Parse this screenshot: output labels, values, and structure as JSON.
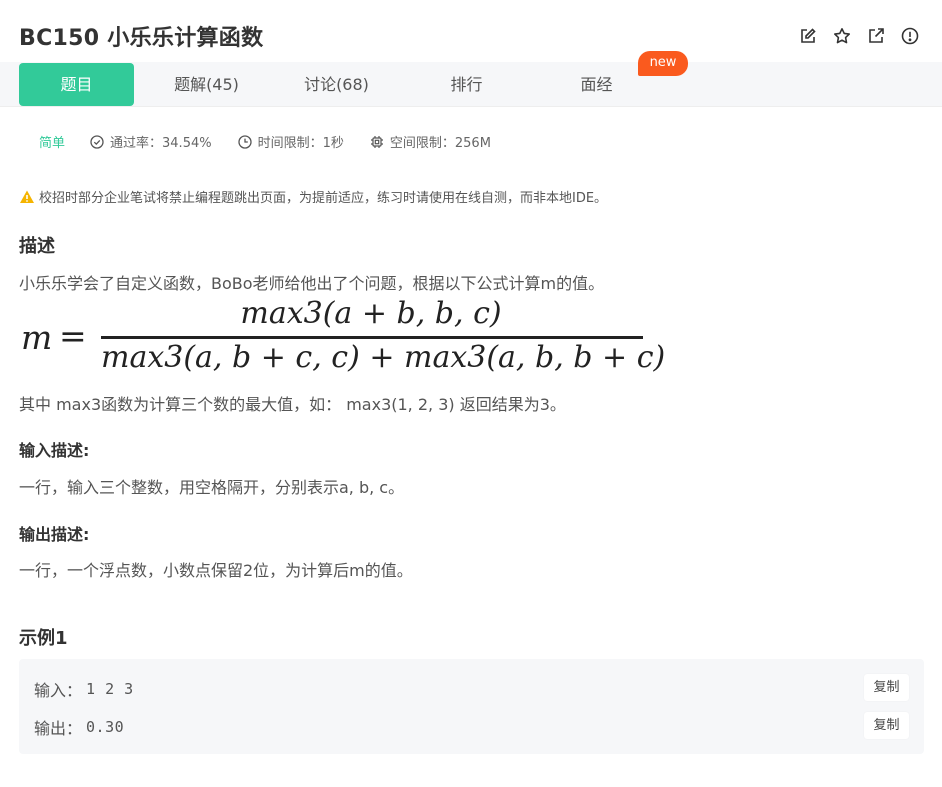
{
  "header": {
    "title": "BC150  小乐乐计算函数",
    "icons": [
      "edit-icon",
      "star-icon",
      "external-link-icon",
      "report-icon"
    ]
  },
  "tabs": [
    {
      "label": "题目",
      "active": true
    },
    {
      "label": "题解(45)",
      "active": false
    },
    {
      "label": "讨论(68)",
      "active": false
    },
    {
      "label": "排行",
      "active": false
    },
    {
      "label": "面经",
      "active": false
    }
  ],
  "new_badge": "new",
  "meta": {
    "difficulty": "简单",
    "pass_rate": "通过率：34.54%",
    "time_limit": "时间限制：1秒",
    "memory_limit": "空间限制：256M"
  },
  "notice": "校招时部分企业笔试将禁止编程题跳出页面，为提前适应，练习时请使用在线自测，而非本地IDE。",
  "description": {
    "heading": "描述",
    "text": "小乐乐学会了自定义函数，BoBo老师给他出了个问题，根据以下公式计算m的值。",
    "formula": {
      "lhs": "m",
      "eq": "=",
      "numerator": "max3(a + b, b, c)",
      "denominator": "max3(a, b + c, c) + max3(a, b, b + c)"
    },
    "note": "其中 max3函数为计算三个数的最大值，如： max3(1, 2, 3) 返回结果为3。"
  },
  "input_desc": {
    "heading": "输入描述:",
    "text": "一行，输入三个整数，用空格隔开，分别表示a, b, c。"
  },
  "output_desc": {
    "heading": "输出描述:",
    "text": "一行，一个浮点数，小数点保留2位，为计算后m的值。"
  },
  "example": {
    "heading": "示例1",
    "input_label": "输入：",
    "input_value": "1 2 3",
    "output_label": "输出：",
    "output_value": "0.30",
    "copy_label": "复制"
  },
  "colors": {
    "accent": "#32ca99",
    "badge": "#fa5a1e",
    "warning": "#f5b400"
  }
}
